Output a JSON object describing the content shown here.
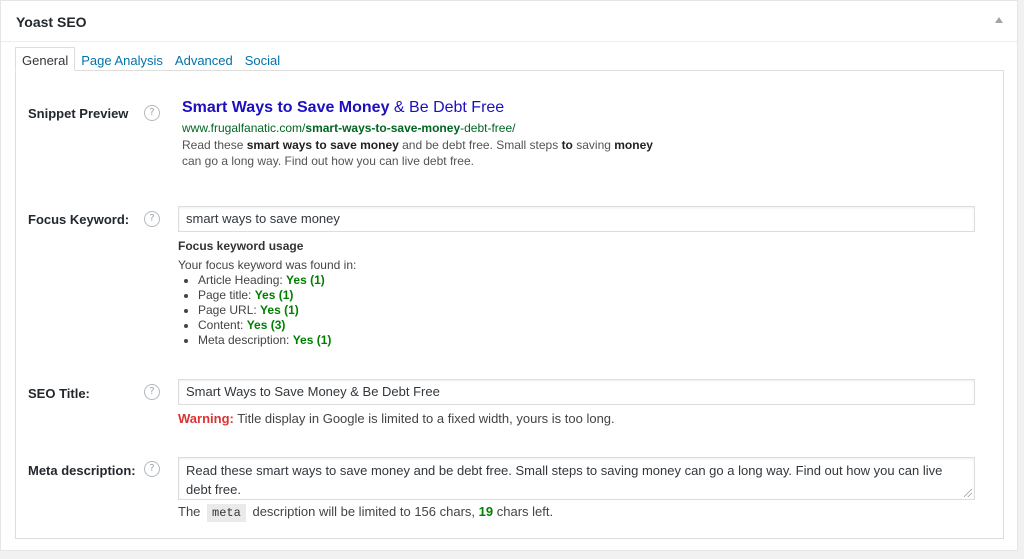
{
  "metabox": {
    "title": "Yoast SEO"
  },
  "tabs": [
    "General",
    "Page Analysis",
    "Advanced",
    "Social"
  ],
  "help_icon_glyph": "?",
  "snippet": {
    "label": "Snippet Preview",
    "title_bold": "Smart Ways to Save Money",
    "title_rest": " & Be Debt Free",
    "url_pre": "www.frugalfanatic.com/",
    "url_bold": "smart-ways-to-save-money",
    "url_post": "-debt-free/",
    "desc_parts": [
      {
        "t": "Read these ",
        "b": false
      },
      {
        "t": "smart ways to save money",
        "b": true
      },
      {
        "t": " and be debt free. Small steps ",
        "b": false
      },
      {
        "t": "to",
        "b": true
      },
      {
        "t": " saving ",
        "b": false
      },
      {
        "t": "money",
        "b": true
      },
      {
        "t": " can go a long way. Find out how you can live debt free.",
        "b": false
      }
    ]
  },
  "focus": {
    "label": "Focus Keyword:",
    "value": "smart ways to save money",
    "usage_heading": "Focus keyword usage",
    "usage_intro": "Your focus keyword was found in:",
    "items": [
      {
        "label": "Article Heading:",
        "result": "Yes (1)"
      },
      {
        "label": "Page title:",
        "result": "Yes (1)"
      },
      {
        "label": "Page URL:",
        "result": "Yes (1)"
      },
      {
        "label": "Content:",
        "result": "Yes (3)"
      },
      {
        "label": "Meta description:",
        "result": "Yes (1)"
      }
    ]
  },
  "seo_title": {
    "label": "SEO Title:",
    "value": "Smart Ways to Save Money & Be Debt Free",
    "warning_label": "Warning:",
    "warning_text": " Title display in Google is limited to a fixed width, yours is too long."
  },
  "meta": {
    "label": "Meta description:",
    "value": "Read these smart ways to save money and be debt free. Small steps to saving money can go a long way. Find out how you can live debt free.",
    "count_pre": "The",
    "count_code": "meta",
    "count_mid": "description will be limited to 156 chars,",
    "count_value": "19",
    "count_post": "chars left."
  },
  "colors": {
    "link": "#0073aa",
    "good": "#008000",
    "warning": "#dc3232",
    "snippet_title": "#1e0fbe",
    "snippet_url": "#006621"
  }
}
